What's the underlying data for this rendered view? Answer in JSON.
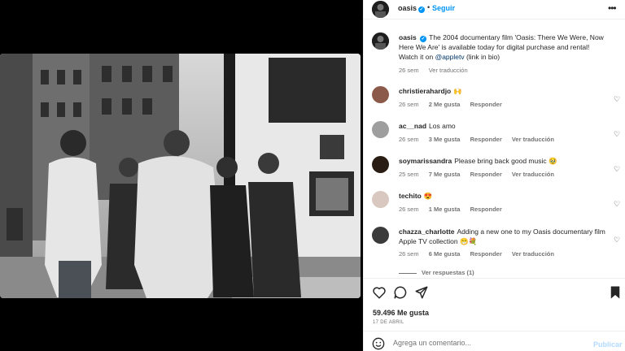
{
  "header": {
    "username": "oasis",
    "separator": "•",
    "follow_label": "Seguir",
    "more_icon": "more-horizontal-icon"
  },
  "caption": {
    "username": "oasis",
    "text": "The 2004 documentary film 'Oasis: There We Were, Now Here We Are' is available today for digital purchase and rental! Watch it on",
    "mention": "@appletv",
    "suffix": "(link in bio)",
    "time": "26 sem",
    "translation": "Ver traducción"
  },
  "comments": [
    {
      "username": "christierahardjo",
      "text": "🙌",
      "time": "26 sem",
      "likes": "2 Me gusta",
      "reply": "Responder",
      "translation": ""
    },
    {
      "username": "ac__nad",
      "text": "Los amo",
      "time": "26 sem",
      "likes": "3 Me gusta",
      "reply": "Responder",
      "translation": "Ver traducción"
    },
    {
      "username": "soymarissandra",
      "text": "Please bring back good music 🥹",
      "time": "25 sem",
      "likes": "7 Me gusta",
      "reply": "Responder",
      "translation": "Ver traducción"
    },
    {
      "username": "techito",
      "text": "😍",
      "time": "26 sem",
      "likes": "1 Me gusta",
      "reply": "Responder",
      "translation": ""
    },
    {
      "username": "chazza_charlotte",
      "text": "Adding a new one to my Oasis documentary film Apple TV collection 😁💐",
      "time": "26 sem",
      "likes": "6 Me gusta",
      "reply": "Responder",
      "translation": "Ver traducción"
    }
  ],
  "view_replies": "Ver respuestas (1)",
  "post": {
    "likes": "59.496 Me gusta",
    "date": "17 DE ABRIL"
  },
  "comment_bar": {
    "placeholder": "Agrega un comentario...",
    "post_label": "Publicar"
  },
  "colors": {
    "accent": "#0095f6",
    "text": "#262626",
    "muted": "#737373",
    "post_disabled": "#b3dbff",
    "background_left": "#000000"
  }
}
